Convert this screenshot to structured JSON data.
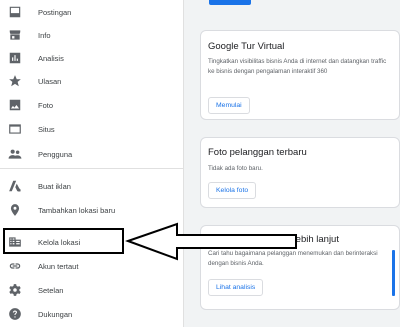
{
  "sidebar": {
    "items": [
      {
        "label": "Postingan",
        "icon": "post-icon"
      },
      {
        "label": "Info",
        "icon": "storefront-icon"
      },
      {
        "label": "Analisis",
        "icon": "insights-icon"
      },
      {
        "label": "Ulasan",
        "icon": "star-icon"
      },
      {
        "label": "Foto",
        "icon": "photo-icon"
      },
      {
        "label": "Situs",
        "icon": "website-icon"
      },
      {
        "label": "Pengguna",
        "icon": "users-icon"
      },
      {
        "label": "Buat iklan",
        "icon": "ads-icon"
      },
      {
        "label": "Tambahkan lokasi baru",
        "icon": "location-pin-icon"
      },
      {
        "label": "Kelola lokasi",
        "icon": "manage-locations-icon"
      },
      {
        "label": "Akun tertaut",
        "icon": "link-icon"
      },
      {
        "label": "Setelan",
        "icon": "gear-icon"
      },
      {
        "label": "Dukungan",
        "icon": "help-icon"
      }
    ]
  },
  "cards": {
    "tour": {
      "title": "Google Tur Virtual",
      "desc": "Tingkatkan visibilitas bisnis Anda di internet dan datangkan traffic ke bisnis dengan pengalaman interaktif 360",
      "button": "Memulai"
    },
    "photos": {
      "title": "Foto pelanggan terbaru",
      "desc": "Tidak ada foto baru.",
      "button": "Kelola foto"
    },
    "learn": {
      "title": "Pelajari bisnis Anda lebih lanjut",
      "desc": "Cari tahu bagaimana pelanggan menemukan dan berinteraksi dengan bisnis Anda.",
      "button": "Lihat analisis"
    }
  },
  "colors": {
    "accent": "#1a73e8",
    "icon": "#5f6368",
    "annotation": "#000000"
  }
}
